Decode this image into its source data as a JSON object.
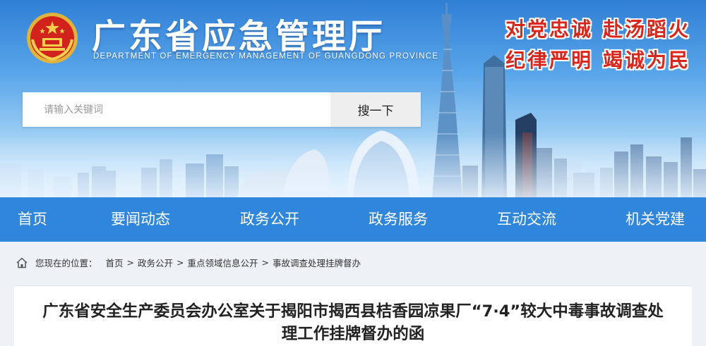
{
  "header": {
    "site_title": "广东省应急管理厅",
    "site_subtitle": "DEPARTMENT OF EMERGENCY MANAGEMENT OF GUANGDONG PROVINCE",
    "slogans": [
      "对党忠诚",
      "赴汤蹈火",
      "纪律严明",
      "竭诚为民"
    ],
    "emblem_icon": "national-emblem-icon"
  },
  "search": {
    "placeholder": "请输入关键词",
    "value": "",
    "button_label": "搜一下"
  },
  "nav": {
    "items": [
      {
        "label": "首页"
      },
      {
        "label": "要闻动态"
      },
      {
        "label": "政务公开"
      },
      {
        "label": "政务服务"
      },
      {
        "label": "互动交流"
      },
      {
        "label": "机关党建"
      }
    ]
  },
  "breadcrumb": {
    "icon": "home-icon",
    "prefix": "您现在的位置：",
    "separator": ">",
    "items": [
      "首页",
      "政务公开",
      "重点领域信息公开",
      "事故调查处理挂牌督办"
    ]
  },
  "article": {
    "title_line1": "广东省安全生产委员会办公室关于揭阳市揭西县桔香园凉果厂“7·4”较大中毒事故调查处",
    "title_line2": "理工作挂牌督办的函"
  },
  "colors": {
    "nav_background": "#2f86da",
    "slogan_red": "#d8261c",
    "page_background": "#eef1f5"
  }
}
